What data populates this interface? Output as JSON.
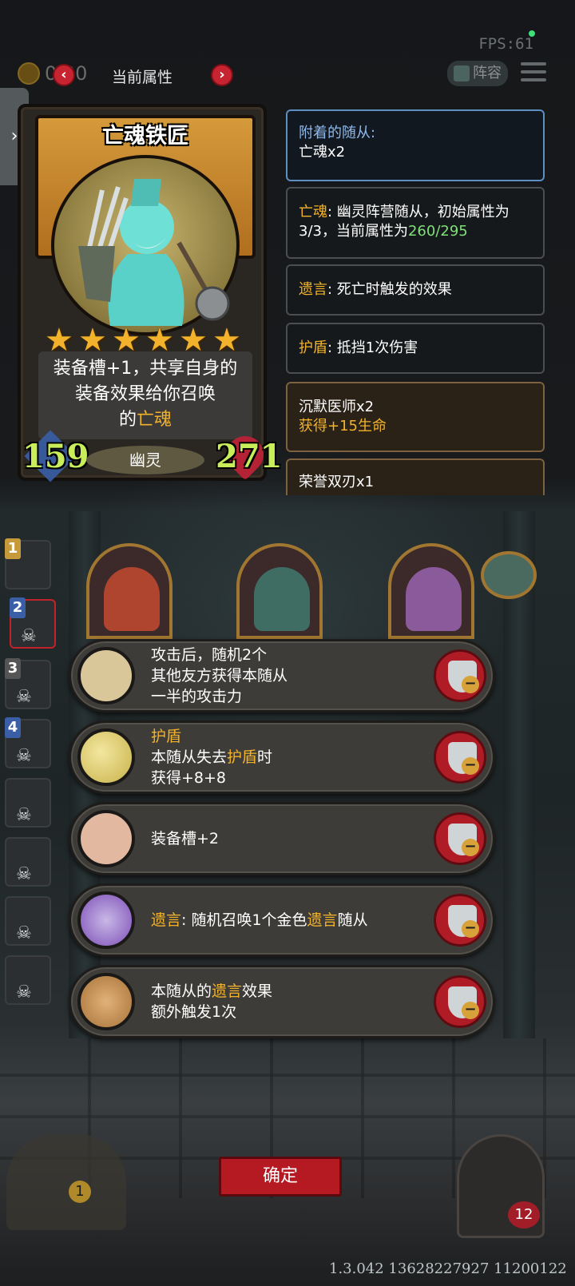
{
  "status": {
    "fps": "FPS:61"
  },
  "header": {
    "coins": "0 20",
    "prev_label": "‹",
    "next_label": "›",
    "title": "当前属性",
    "lineup_label": "阵容",
    "side_tab_label": "›"
  },
  "card": {
    "name": "亡魂铁匠",
    "stars": 6,
    "desc_line1": "装备槽+1，共享自身的",
    "desc_line2": "装备效果给你召唤",
    "desc_line3_prefix": "的",
    "desc_line3_keyword": "亡魂",
    "attack": "159",
    "health": "271",
    "tribe": "幽灵"
  },
  "info_panels": {
    "attached_title": "附着的随从:",
    "attached_value": "亡魂x2",
    "ghost_kw": "亡魂",
    "ghost_text1": ": 幽灵阵营随从，初始属性为",
    "ghost_text2": "3/3，当前属性为",
    "ghost_value": "260/295",
    "deathrattle_kw": "遗言",
    "deathrattle_text": ": 死亡时触发的效果",
    "shield_kw": "护盾",
    "shield_text": ": 抵挡1次伤害",
    "item1_title": "沉默医师x2",
    "item1_effect": "获得+15生命",
    "item2_title": "荣誉双刃x1"
  },
  "slots": [
    "1",
    "2",
    "3",
    "4"
  ],
  "options": [
    {
      "line1": "攻击后，随机2个",
      "line2": "其他友方获得本随从",
      "line3": "一半的攻击力",
      "icon": "axe-icon"
    },
    {
      "kw": "护盾",
      "line2_pre": "本随从失去",
      "line2_kw": "护盾",
      "line2_post": "时",
      "line3": "获得+8+8",
      "icon": "moon-icon"
    },
    {
      "line1": "装备槽+2",
      "icon": "pig-icon"
    },
    {
      "kw": "遗言",
      "mid": ": 随机召唤1个金色",
      "kw2": "遗言",
      "post": "随从",
      "icon": "tomb-icon"
    },
    {
      "pre": "本随从的",
      "kw": "遗言",
      "post": "效果",
      "line2": "额外触发1次",
      "icon": "skull-coin-icon"
    }
  ],
  "footer": {
    "confirm_label": "确定",
    "chest_count": "1",
    "hero_health": "12",
    "version": "1.3.042 13628227927 11200122"
  }
}
